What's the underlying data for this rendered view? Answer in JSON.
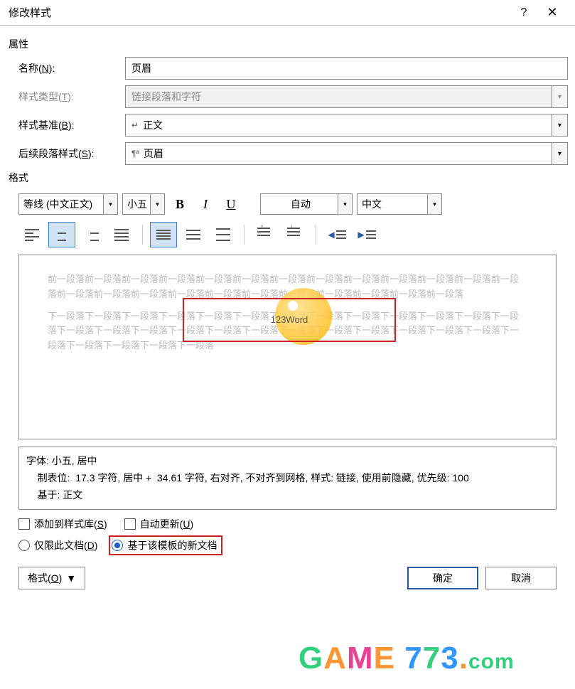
{
  "title": "修改样式",
  "sections": {
    "properties": "属性",
    "format": "格式"
  },
  "labels": {
    "name": "名称(N):",
    "styleType": "样式类型(T):",
    "basedOn": "样式基准(B):",
    "following": "后续段落样式(S):"
  },
  "values": {
    "name": "页眉",
    "styleType": "链接段落和字符",
    "basedOn": "正文",
    "following": "页眉"
  },
  "formatting": {
    "font": "等线 (中文正文)",
    "size": "小五",
    "bold": "B",
    "italic": "I",
    "underline": "U",
    "color": "自动",
    "script": "中文"
  },
  "preview": {
    "prev": "前一段落前一段落前一段落前一段落前一段落前一段落前一段落前一段落前一段落前一段落前一段落前一段落前一段落前一段落前一段落前一段落前一段落前一段落前一段落前一段落前一段落前一段落前一段落前一段落",
    "sample": "123Word",
    "next": "下一段落下一段落下一段落下一段落下一段落下一段落下一段落下一段落下一段落下一段落下一段落下一段落下一段落下一段落下一段落下一段落下一段落下一段落下一段落下一段落下一段落下一段落下一段落下一段落下一段落下一段落下一段落下一段落下一段落下一段落"
  },
  "description": {
    "line1": "字体: 小五, 居中",
    "line2": "    制表位:  17.3 字符, 居中 +  34.61 字符, 右对齐, 不对齐到网格, 样式: 链接, 使用前隐藏, 优先级: 100",
    "line3": "    基于: 正文"
  },
  "checkboxes": {
    "addGallery": "添加到样式库(S)",
    "autoUpdate": "自动更新(U)"
  },
  "radios": {
    "docOnly": "仅限此文档(D)",
    "template": "基于该模板的新文档"
  },
  "footer": {
    "format": "格式(O)",
    "ok": "确定",
    "cancel": "取消"
  },
  "watermark": "GAME 773.com"
}
